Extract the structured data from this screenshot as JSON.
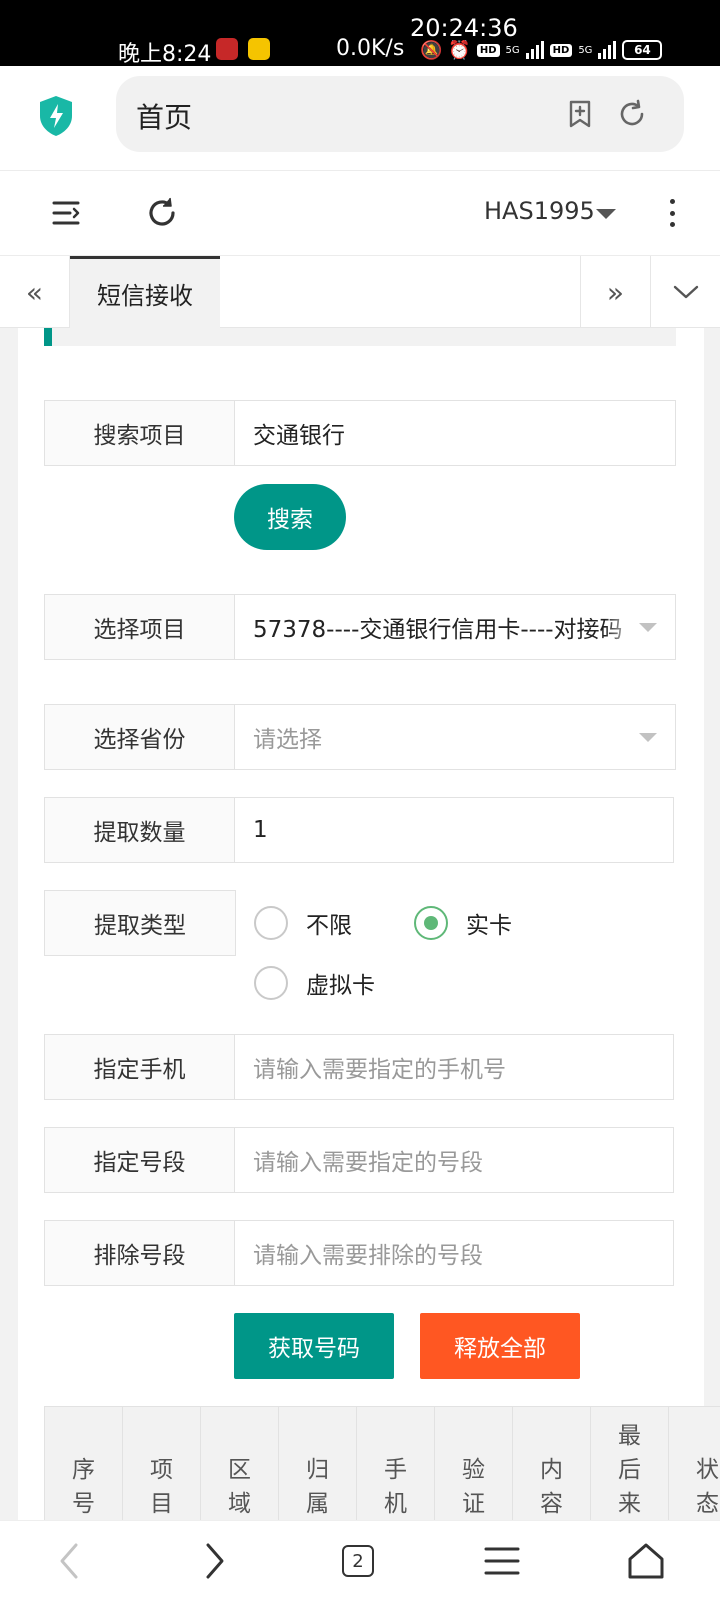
{
  "status_bar": {
    "clock_top": "20:24:36",
    "time": "晚上8:24",
    "speed": "0.0K/s",
    "net1": "5G",
    "net2": "5G",
    "hd1": "HD",
    "hd2": "HD",
    "battery": "64"
  },
  "browser": {
    "url_text": "首页",
    "tab_count": "2"
  },
  "header": {
    "username": "HAS1995"
  },
  "tabs": {
    "active_label": "短信接收"
  },
  "form": {
    "search_project_label": "搜索项目",
    "search_project_value": "交通银行",
    "search_button": "搜索",
    "select_project_label": "选择项目",
    "select_project_value": "57378----交通银行信用卡----对接码",
    "select_province_label": "选择省份",
    "select_province_placeholder": "请选择",
    "quantity_label": "提取数量",
    "quantity_value": "1",
    "type_label": "提取类型",
    "type_options": [
      "不限",
      "实卡",
      "虚拟卡"
    ],
    "type_selected": "实卡",
    "phone_label": "指定手机",
    "phone_placeholder": "请输入需要指定的手机号",
    "segment_label": "指定号段",
    "segment_placeholder": "请输入需要指定的号段",
    "exclude_label": "排除号段",
    "exclude_placeholder": "请输入需要排除的号段",
    "get_button": "获取号码",
    "release_button": "释放全部"
  },
  "table": {
    "headers": [
      "序号",
      "项目",
      "区域",
      "归属",
      "手机",
      "验证",
      "内容",
      "最后来信",
      "状态"
    ]
  },
  "colors": {
    "primary": "#009688",
    "danger": "#ff5722",
    "radio_checked": "#5fb878"
  }
}
